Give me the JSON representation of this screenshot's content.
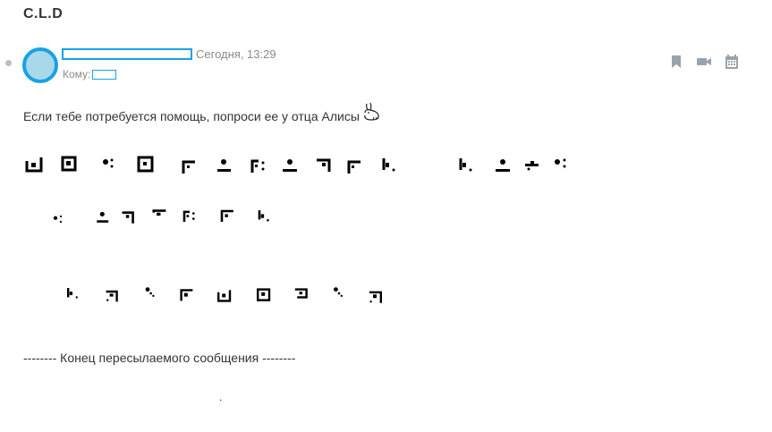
{
  "message": {
    "subject": "C.L.D",
    "date": "Сегодня, 13:29",
    "to_label": "Кому:",
    "body": "Если тебе потребуется помощь, попроси ее у отца Алисы",
    "footer": "-------- Конец пересылаемого сообщения --------",
    "trailing_mark": "."
  },
  "colors": {
    "accent": "#17a2e6",
    "avatar_fill": "#a8d8ea",
    "icon_gray": "#9aa3ab"
  },
  "icons": [
    "bookmark-icon",
    "video-icon",
    "calendar-icon",
    "rabbit-icon"
  ]
}
